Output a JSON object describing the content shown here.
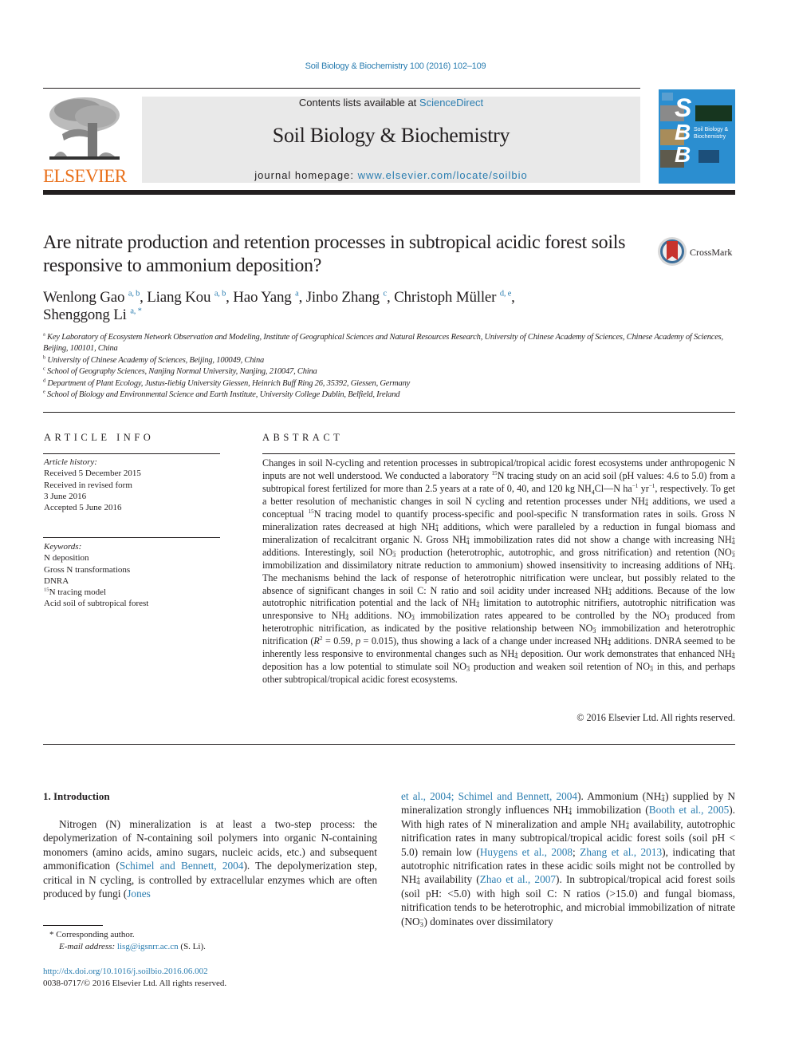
{
  "header": {
    "journal_ref": "Soil Biology & Biochemistry 100 (2016) 102–109",
    "contents_prefix": "Contents lists available at ",
    "contents_link": "ScienceDirect",
    "journal_title": "Soil Biology & Biochemistry",
    "homepage_prefix": "journal homepage: ",
    "homepage_link": "www.elsevier.com/locate/soilbio",
    "publisher_logo": "ELSEVIER",
    "cover": {
      "letters": [
        "S",
        "B",
        "B"
      ],
      "title_line1": "Soil Biology &",
      "title_line2": "Biochemistry"
    }
  },
  "article": {
    "title": "Are nitrate production and retention processes in subtropical acidic forest soils responsive to ammonium deposition?",
    "crossmark_label": "CrossMark",
    "authors": [
      {
        "name": "Wenlong Gao",
        "aff": "a, b"
      },
      {
        "name": "Liang Kou",
        "aff": "a, b"
      },
      {
        "name": "Hao Yang",
        "aff": "a"
      },
      {
        "name": "Jinbo Zhang",
        "aff": "c"
      },
      {
        "name": "Christoph Müller",
        "aff": "d, e"
      },
      {
        "name": "Shenggong Li",
        "aff": "a, *"
      }
    ],
    "affiliations": [
      {
        "key": "a",
        "text": "Key Laboratory of Ecosystem Network Observation and Modeling, Institute of Geographical Sciences and Natural Resources Research, University of Chinese Academy of Sciences, Chinese Academy of Sciences, Beijing, 100101, China"
      },
      {
        "key": "b",
        "text": "University of Chinese Academy of Sciences, Beijing, 100049, China"
      },
      {
        "key": "c",
        "text": "School of Geography Sciences, Nanjing Normal University, Nanjing, 210047, China"
      },
      {
        "key": "d",
        "text": "Department of Plant Ecology, Justus-liebig University Giessen, Heinrich Buff Ring 26, 35392, Giessen, Germany"
      },
      {
        "key": "e",
        "text": "School of Biology and Environmental Science and Earth Institute, University College Dublin, Belfield, Ireland"
      }
    ]
  },
  "article_info": {
    "heading": "ARTICLE INFO",
    "history_label": "Article history:",
    "history": [
      "Received 5 December 2015",
      "Received in revised form",
      "3 June 2016",
      "Accepted 5 June 2016"
    ],
    "keywords_label": "Keywords:",
    "keywords": [
      "N deposition",
      "Gross N transformations",
      "DNRA",
      "15N tracing model",
      "Acid soil of subtropical forest"
    ]
  },
  "abstract": {
    "heading": "ABSTRACT",
    "text": "Changes in soil N-cycling and retention processes in subtropical/tropical acidic forest ecosystems under anthropogenic N inputs are not well understood. We conducted a laboratory 15N tracing study on an acid soil (pH values: 4.6 to 5.0) from a subtropical forest fertilized for more than 2.5 years at a rate of 0, 40, and 120 kg NH4Cl—N ha−1 yr−1, respectively. To get a better resolution of mechanistic changes in soil N cycling and retention processes under NH4+ additions, we used a conceptual 15N tracing model to quantify process-specific and pool-specific N transformation rates in soils. Gross N mineralization rates decreased at high NH4+ additions, which were paralleled by a reduction in fungal biomass and mineralization of recalcitrant organic N. Gross NH4+ immobilization rates did not show a change with increasing NH4+ additions. Interestingly, soil NO3− production (heterotrophic, autotrophic, and gross nitrification) and retention (NO3− immobilization and dissimilatory nitrate reduction to ammonium) showed insensitivity to increasing additions of NH4+. The mechanisms behind the lack of response of heterotrophic nitrification were unclear, but possibly related to the absence of significant changes in soil C: N ratio and soil acidity under increased NH4+ additions. Because of the low autotrophic nitrification potential and the lack of NH4+ limitation to autotrophic nitrifiers, autotrophic nitrification was unresponsive to NH4+ additions. NO3− immobilization rates appeared to be controlled by the NO3− produced from heterotrophic nitrification, as indicated by the positive relationship between NO3− immobilization and heterotrophic nitrification (R2 = 0.59, p = 0.015), thus showing a lack of a change under increased NH4+ additions. DNRA seemed to be inherently less responsive to environmental changes such as NH4+ deposition. Our work demonstrates that enhanced NH4+ deposition has a low potential to stimulate soil NO3− production and weaken soil retention of NO3− in this, and perhaps other subtropical/tropical acidic forest ecosystems.",
    "copyright": "© 2016 Elsevier Ltd. All rights reserved."
  },
  "introduction": {
    "heading": "1.  Introduction",
    "left_text": "Nitrogen (N) mineralization is at least a two-step process: the depolymerization of N-containing soil polymers into organic N-containing monomers (amino acids, amino sugars, nucleic acids, etc.) and subsequent ammonification (Schimel and Bennett, 2004). The depolymerization step, critical in N cycling, is controlled by extracellular enzymes which are often produced by fungi (Jones",
    "right_text": "et al., 2004; Schimel and Bennett, 2004). Ammonium (NH4+) supplied by N mineralization strongly influences NH4+ immobilization (Booth et al., 2005). With high rates of N mineralization and ample NH4+ availability, autotrophic nitrification rates in many subtropical/tropical acidic forest soils (soil pH < 5.0) remain low (Huygens et al., 2008; Zhang et al., 2013), indicating that autotrophic nitrification rates in these acidic soils might not be controlled by NH4+ availability (Zhao et al., 2007). In subtropical/tropical acid forest soils (soil pH: <5.0) with high soil C: N ratios (>15.0) and fungal biomass, nitrification tends to be heterotrophic, and microbial immobilization of nitrate (NO3−) dominates over dissimilatory",
    "citations": [
      "Schimel and Bennett, 2004",
      "Jones et al., 2004",
      "Booth et al., 2005",
      "Huygens et al., 2008",
      "Zhang et al., 2013",
      "Zhao et al., 2007"
    ]
  },
  "footnotes": {
    "corresponding": "* Corresponding author.",
    "email_label": "E-mail address: ",
    "email": "lisg@igsnrr.ac.cn",
    "email_suffix": " (S. Li).",
    "doi": "http://dx.doi.org/10.1016/j.soilbio.2016.06.002",
    "issn_line": "0038-0717/© 2016 Elsevier Ltd. All rights reserved."
  }
}
